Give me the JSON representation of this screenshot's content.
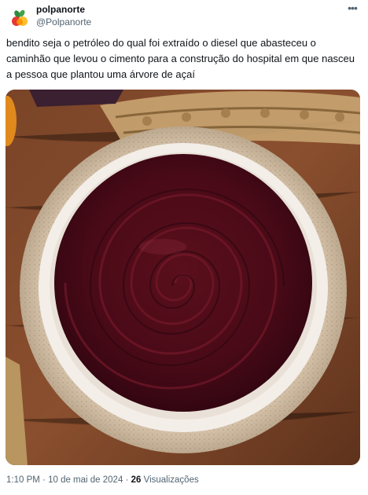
{
  "tweet": {
    "display_name": "polpanorte",
    "handle": "@Polpanorte",
    "more_icon": "more-horizontal-icon",
    "text": "bendito seja o petróleo do qual foi extraído o diesel que abasteceu o caminhão que levou o cimento para a construção do hospital em que nasceu a pessoa que plantou uma árvore de açaí",
    "time": "1:10 PM",
    "separator_1": "·",
    "date": "10 de mai de 2024",
    "separator_2": "·",
    "views_count": "26",
    "views_label": "Visualizações"
  },
  "media": {
    "description_icon": "acai-bowl-photo"
  }
}
